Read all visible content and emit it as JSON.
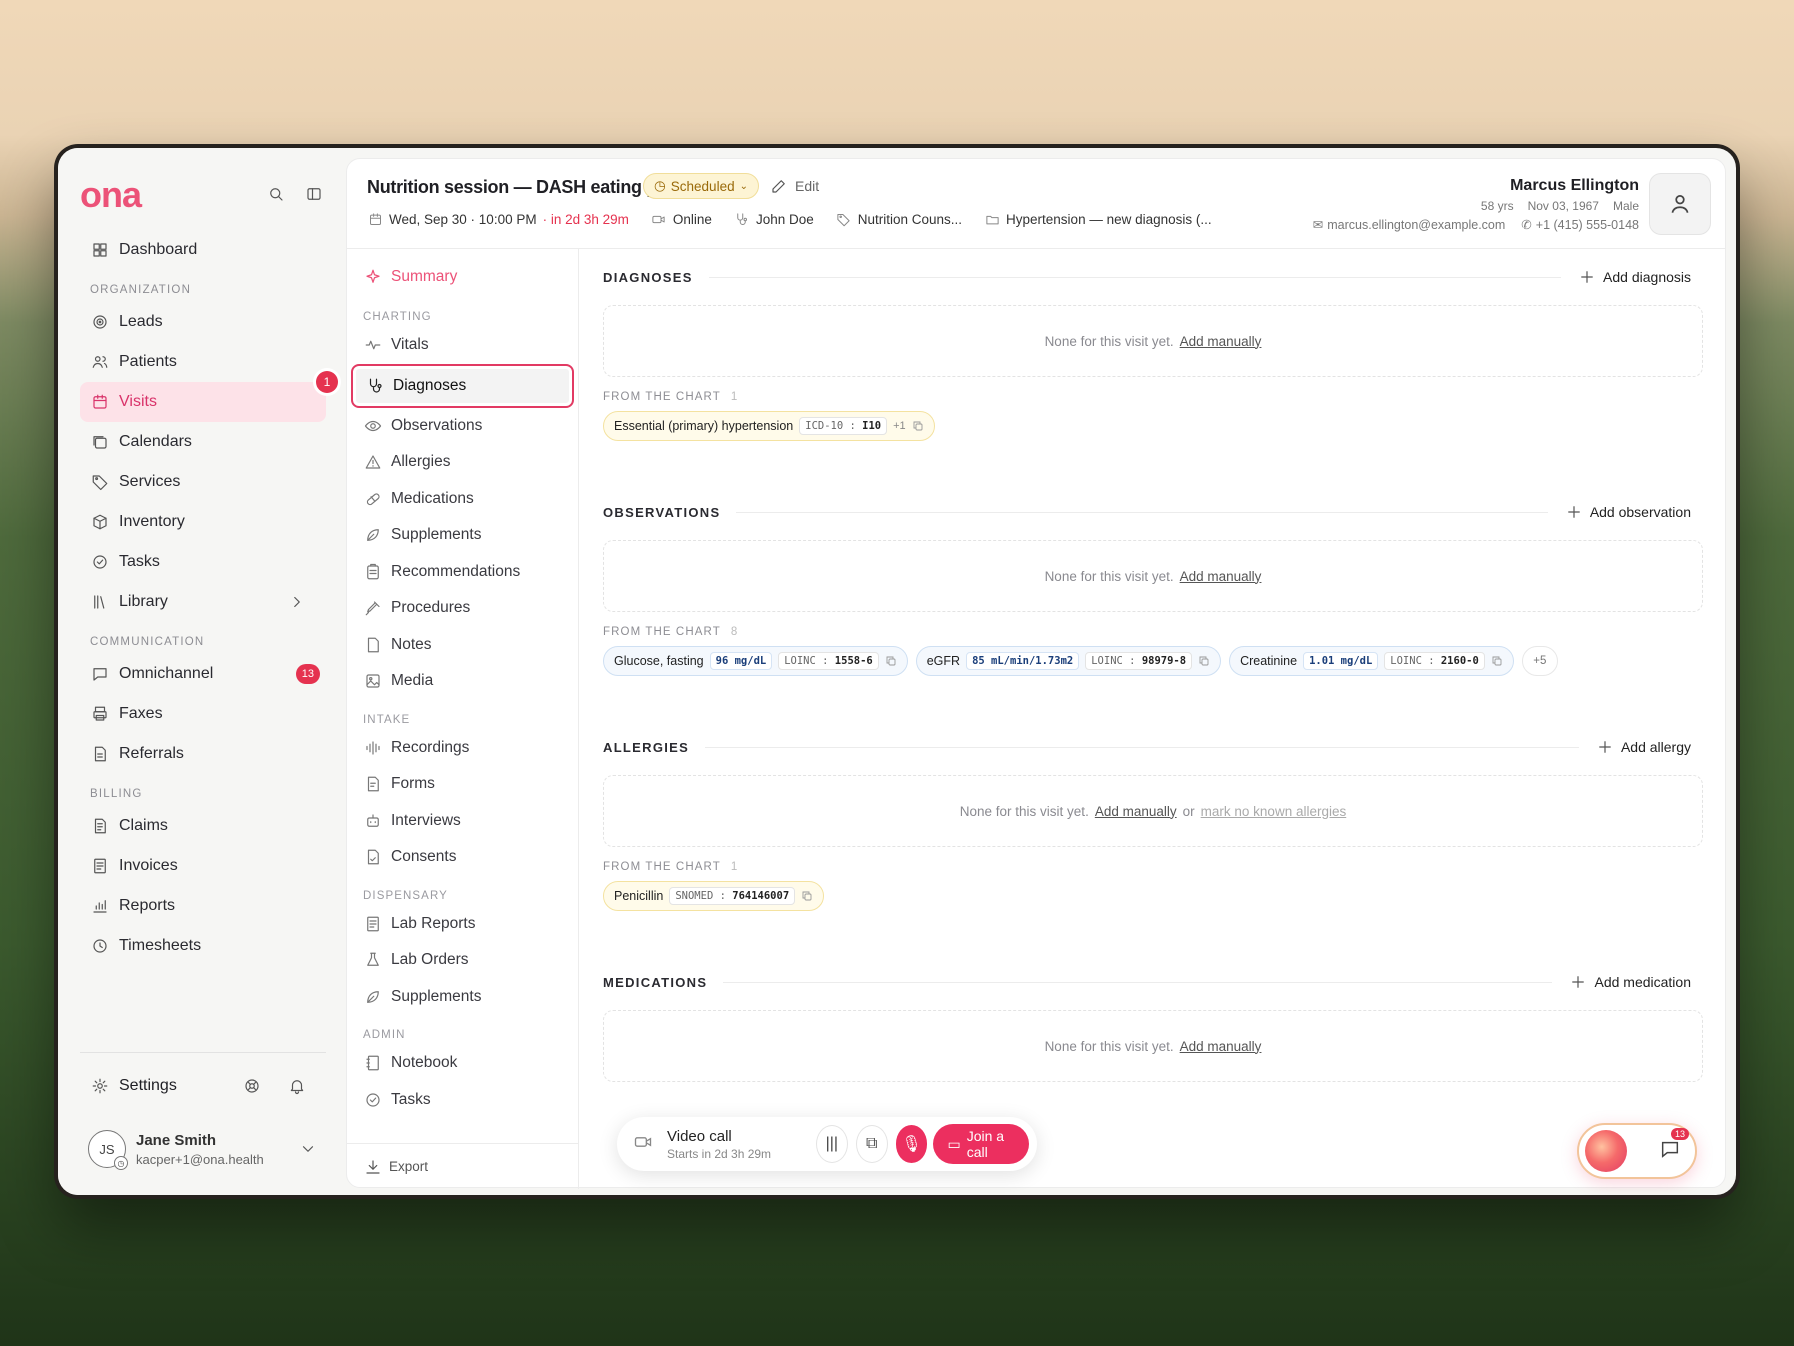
{
  "app": {
    "logo": "ona"
  },
  "sidebar": {
    "top": [
      {
        "label": "Dashboard",
        "icon": "dashboard-icon"
      }
    ],
    "sections": [
      {
        "title": "ORGANIZATION",
        "items": [
          {
            "label": "Leads",
            "icon": "target-icon"
          },
          {
            "label": "Patients",
            "icon": "users-icon"
          },
          {
            "label": "Visits",
            "icon": "calendar-icon",
            "active": true
          },
          {
            "label": "Calendars",
            "icon": "calendars-icon"
          },
          {
            "label": "Services",
            "icon": "tag-icon"
          },
          {
            "label": "Inventory",
            "icon": "box-icon"
          },
          {
            "label": "Tasks",
            "icon": "check-circle-icon"
          },
          {
            "label": "Library",
            "icon": "library-icon",
            "chevron": true
          }
        ]
      },
      {
        "title": "COMMUNICATION",
        "items": [
          {
            "label": "Omnichannel",
            "icon": "chat-icon",
            "badge": "13"
          },
          {
            "label": "Faxes",
            "icon": "printer-icon"
          },
          {
            "label": "Referrals",
            "icon": "document-icon"
          }
        ]
      },
      {
        "title": "BILLING",
        "items": [
          {
            "label": "Claims",
            "icon": "file-icon"
          },
          {
            "label": "Invoices",
            "icon": "invoice-icon"
          },
          {
            "label": "Reports",
            "icon": "chart-icon"
          },
          {
            "label": "Timesheets",
            "icon": "clock-icon"
          }
        ]
      }
    ],
    "step_badge": "1",
    "settings_label": "Settings",
    "user": {
      "initials": "JS",
      "name": "Jane Smith",
      "email": "kacper+1@ona.health"
    }
  },
  "header": {
    "title": "Nutrition session — DASH eating plan",
    "status": "Scheduled",
    "edit": "Edit",
    "date": "Wed, Sep 30 · 10:00 PM",
    "relative": "· in 2d 3h 29m",
    "mode": "Online",
    "provider": "John Doe",
    "service": "Nutrition Couns...",
    "case": "Hypertension — new diagnosis (..."
  },
  "patient": {
    "name": "Marcus Ellington",
    "age": "58 yrs",
    "dob": "Nov 03, 1967",
    "sex": "Male",
    "email": "marcus.ellington@example.com",
    "phone": "+1 (415) 555-0148"
  },
  "subnav": {
    "summary": "Summary",
    "sections": [
      {
        "title": "CHARTING",
        "items": [
          "Vitals",
          "Diagnoses",
          "Observations",
          "Allergies",
          "Medications",
          "Supplements",
          "Recommendations",
          "Procedures",
          "Notes",
          "Media"
        ]
      },
      {
        "title": "INTAKE",
        "items": [
          "Recordings",
          "Forms",
          "Interviews",
          "Consents"
        ]
      },
      {
        "title": "DISPENSARY",
        "items": [
          "Lab Reports",
          "Lab Orders",
          "Supplements"
        ]
      },
      {
        "title": "ADMIN",
        "items": [
          "Notebook",
          "Tasks"
        ]
      }
    ],
    "selected": "Diagnoses",
    "export": "Export"
  },
  "content": {
    "empty_text": "None for this visit yet.",
    "add_manually": "Add manually",
    "or": "or",
    "no_known_allergies": "mark no known allergies",
    "from_chart": "FROM THE CHART",
    "diagnoses": {
      "title": "DIAGNOSES",
      "add": "Add diagnosis",
      "count": "1",
      "chips": [
        {
          "name": "Essential (primary) hypertension",
          "system": "ICD-10",
          "code": "I10",
          "extra": "+1"
        }
      ]
    },
    "observations": {
      "title": "OBSERVATIONS",
      "add": "Add observation",
      "count": "8",
      "more": "+5",
      "chips": [
        {
          "name": "Glucose, fasting",
          "value": "96 mg/dL",
          "system": "LOINC",
          "code": "1558-6"
        },
        {
          "name": "eGFR",
          "value": "85 mL/min/1.73m2",
          "system": "LOINC",
          "code": "98979-8"
        },
        {
          "name": "Creatinine",
          "value": "1.01 mg/dL",
          "system": "LOINC",
          "code": "2160-0"
        }
      ]
    },
    "allergies": {
      "title": "ALLERGIES",
      "add": "Add allergy",
      "count": "1",
      "chips": [
        {
          "name": "Penicillin",
          "system": "SNOMED",
          "code": "764146007"
        }
      ]
    },
    "medications": {
      "title": "MEDICATIONS",
      "add": "Add medication"
    }
  },
  "callbar": {
    "title": "Video call",
    "sub": "Starts in 2d 3h 29m",
    "join": "Join a call"
  },
  "assistant": {
    "badge": "13"
  }
}
